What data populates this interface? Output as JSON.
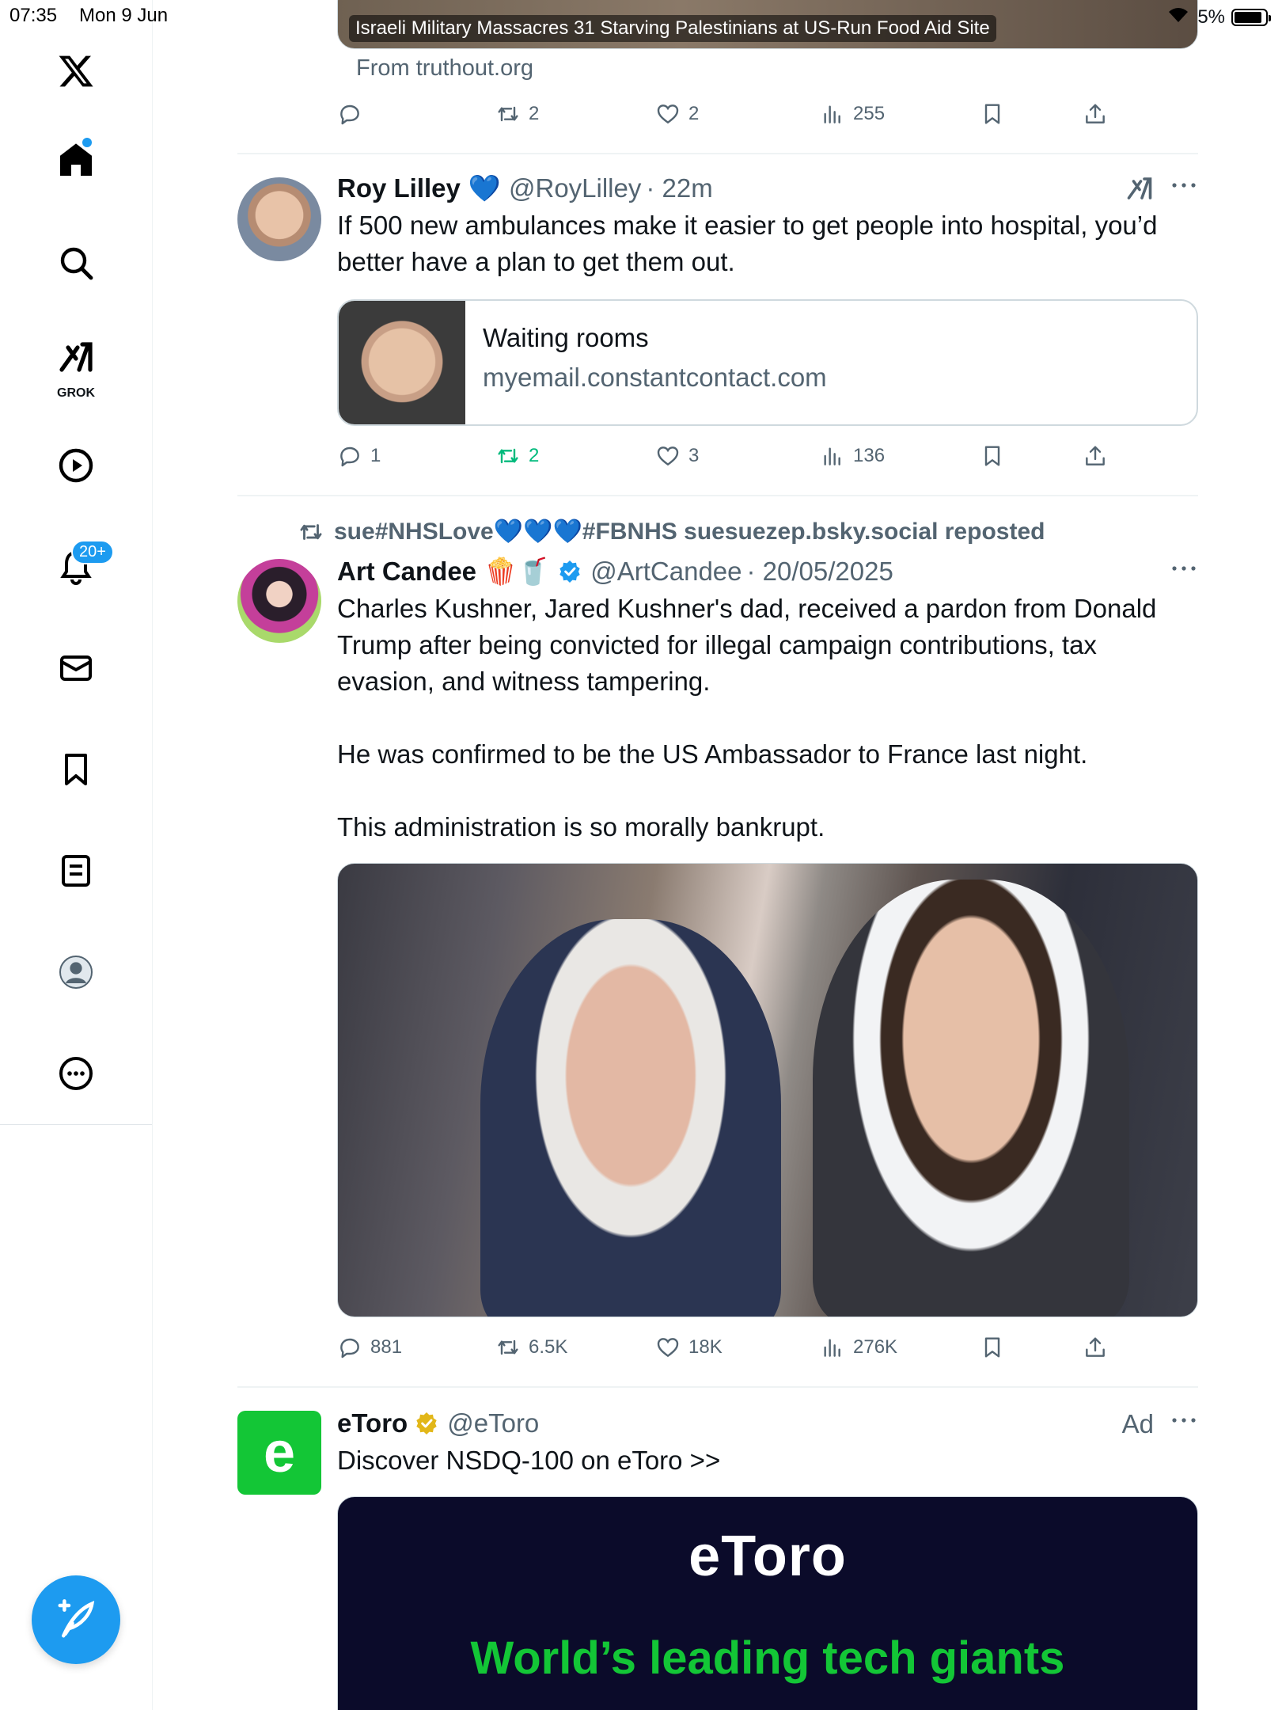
{
  "status_bar": {
    "time": "07:35",
    "date": "Mon 9 Jun",
    "battery": "5%"
  },
  "sidebar": {
    "notifications_badge": "20+",
    "grok_label": "GROK"
  },
  "tweets": [
    {
      "media_caption": "Israeli Military Massacres 31 Starving Palestinians at US-Run Food Aid Site",
      "source": "From truthout.org",
      "actions": {
        "replies": "",
        "reposts": "2",
        "likes": "2",
        "views": "255"
      }
    },
    {
      "name": "Roy Lilley",
      "emoji": "💙",
      "handle": "@RoyLilley",
      "time": "· 22m",
      "text": "If 500 new ambulances make it easier to get people into hospital, you’d better have a plan to get them out.",
      "card": {
        "title": "Waiting rooms",
        "domain": "myemail.constantcontact.com"
      },
      "actions": {
        "replies": "1",
        "reposts": "2",
        "likes": "3",
        "views": "136"
      }
    },
    {
      "repost_by": "sue#NHSLove💙💙💙#FBNHS suesuezep.bsky.social reposted",
      "name": "Art Candee",
      "emoji": "🍿🥤",
      "handle": "@ArtCandee",
      "time": "· 20/05/2025",
      "text": "Charles Kushner, Jared Kushner's dad, received a pardon from Donald Trump after being convicted for illegal campaign contributions, tax evasion, and witness tampering.\n\nHe was confirmed to be the US Ambassador to France last night.\n\nThis administration is so morally bankrupt.",
      "actions": {
        "replies": "881",
        "reposts": "6.5K",
        "likes": "18K",
        "views": "276K"
      }
    },
    {
      "name": "eToro",
      "handle": "@eToro",
      "ad_label": "Ad",
      "text": "Discover NSDQ-100 on eToro >>",
      "banner": {
        "logo": "eToro",
        "headline": "World’s leading tech giants"
      }
    }
  ],
  "colors": {
    "accent": "#1d9bf0",
    "repost_active": "#00ba7c",
    "etoro_green": "#13c636",
    "etoro_dark": "#0b0b2a"
  },
  "icons": [
    "x-logo-icon",
    "home-icon",
    "search-icon",
    "grok-icon",
    "video-icon",
    "bell-icon",
    "mail-icon",
    "bookmark-icon",
    "list-icon",
    "profile-icon",
    "more-icon",
    "compose-icon",
    "reply-icon",
    "repost-icon",
    "like-icon",
    "views-icon",
    "share-icon"
  ]
}
